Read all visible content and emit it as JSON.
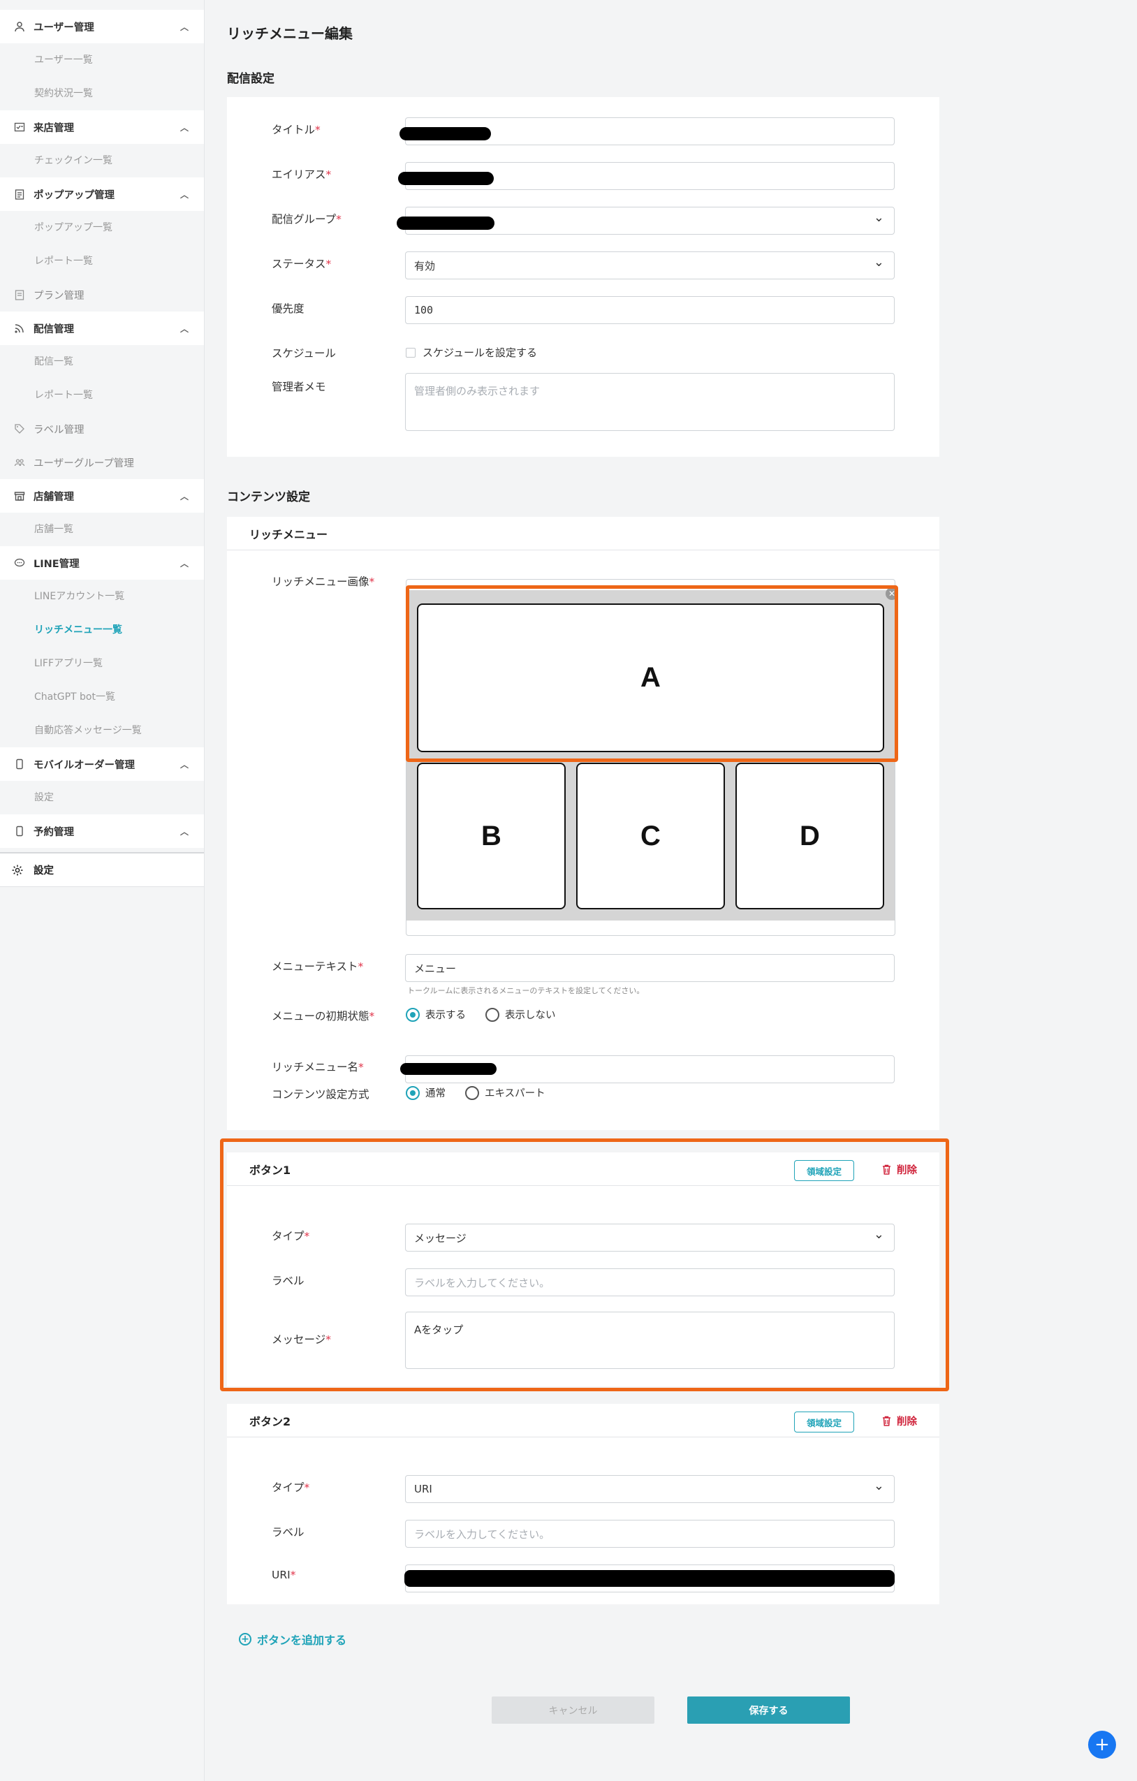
{
  "sidebar": {
    "user_mgmt": "ユーザー管理",
    "user_list": "ユーザー一覧",
    "contract_list": "契約状況一覧",
    "visit_mgmt": "来店管理",
    "checkin_list": "チェックイン一覧",
    "popup_mgmt": "ポップアップ管理",
    "popup_list": "ポップアップ一覧",
    "popup_report": "レポート一覧",
    "plan_mgmt": "プラン管理",
    "delivery_mgmt": "配信管理",
    "delivery_list": "配信一覧",
    "delivery_report": "レポート一覧",
    "label_mgmt": "ラベル管理",
    "usergroup_mgmt": "ユーザーグループ管理",
    "store_mgmt": "店舗管理",
    "store_list": "店舗一覧",
    "line_mgmt": "LINE管理",
    "line_account_list": "LINEアカウント一覧",
    "richmenu_list": "リッチメニュー一覧",
    "liff_list": "LIFFアプリ一覧",
    "chatgpt_list": "ChatGPT bot一覧",
    "autoreply_list": "自動応答メッセージ一覧",
    "mobile_order_mgmt": "モバイルオーダー管理",
    "mobile_order_settings": "設定",
    "reservation_mgmt": "予約管理",
    "settings": "設定"
  },
  "page": {
    "title": "リッチメニュー編集"
  },
  "delivery": {
    "section_title": "配信設定",
    "title_label": "タイトル",
    "alias_label": "エイリアス",
    "group_label": "配信グループ",
    "status_label": "ステータス",
    "status_value": "有効",
    "priority_label": "優先度",
    "priority_value": "100",
    "schedule_label": "スケジュール",
    "schedule_checkbox": "スケジュールを設定する",
    "memo_label": "管理者メモ",
    "memo_placeholder": "管理者側のみ表示されます"
  },
  "content": {
    "section_title": "コンテンツ設定",
    "card_title": "リッチメニュー",
    "image_label": "リッチメニュー画像",
    "cells": [
      "A",
      "B",
      "C",
      "D"
    ],
    "menu_text_label": "メニューテキスト",
    "menu_text_value": "メニュー",
    "menu_text_hint": "トークルームに表示されるメニューのテキストを設定してください。",
    "initial_state_label": "メニューの初期状態",
    "initial_state_show": "表示する",
    "initial_state_hide": "表示しない",
    "richmenu_name_label": "リッチメニュー名",
    "method_label": "コンテンツ設定方式",
    "method_normal": "通常",
    "method_expert": "エキスパート"
  },
  "button1": {
    "title": "ボタン1",
    "area_button": "領域設定",
    "delete_button": "削除",
    "type_label": "タイプ",
    "type_value": "メッセージ",
    "label_label": "ラベル",
    "label_placeholder": "ラベルを入力してください。",
    "message_label": "メッセージ",
    "message_value": "Aをタップ"
  },
  "button2": {
    "title": "ボタン2",
    "area_button": "領域設定",
    "delete_button": "削除",
    "type_label": "タイプ",
    "type_value": "URI",
    "label_label": "ラベル",
    "label_placeholder": "ラベルを入力してください。",
    "uri_label": "URI"
  },
  "actions": {
    "add_button": "ボタンを追加する",
    "cancel": "キャンセル",
    "save": "保存する"
  },
  "colors": {
    "accent": "#1fa3b8",
    "highlight": "#ee6617",
    "danger": "#d0243c",
    "required": "#e0344a"
  }
}
